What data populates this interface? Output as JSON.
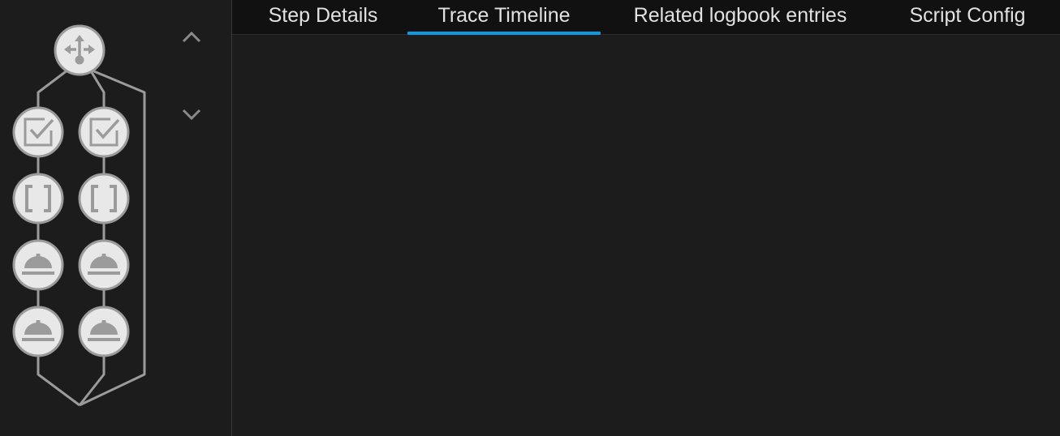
{
  "tabs": [
    {
      "label": "Step Details",
      "active": false
    },
    {
      "label": "Trace Timeline",
      "active": true
    },
    {
      "label": "Related logbook entries",
      "active": false
    },
    {
      "label": "Script Config",
      "active": false
    }
  ],
  "graph": {
    "root_icon": "choose-icon",
    "branches": [
      {
        "nodes": [
          "condition-check-icon",
          "variables-icon",
          "service-call-icon",
          "service-call-icon"
        ]
      },
      {
        "nodes": [
          "condition-check-icon",
          "variables-icon",
          "service-call-icon",
          "service-call-icon"
        ]
      },
      {
        "nodes": []
      }
    ]
  },
  "navigation": {
    "up_icon": "chevron-up-icon",
    "down_icon": "chevron-down-icon"
  },
  "colors": {
    "background": "#1c1c1c",
    "tab_bar": "#111111",
    "tab_text": "#e1e1e1",
    "active_underline": "#0d9ae5",
    "node_fill": "#e8e8e8",
    "node_icon": "#9b9b9b",
    "graph_line": "#9b9b9b",
    "nav_chevron": "#8a8a8a"
  }
}
